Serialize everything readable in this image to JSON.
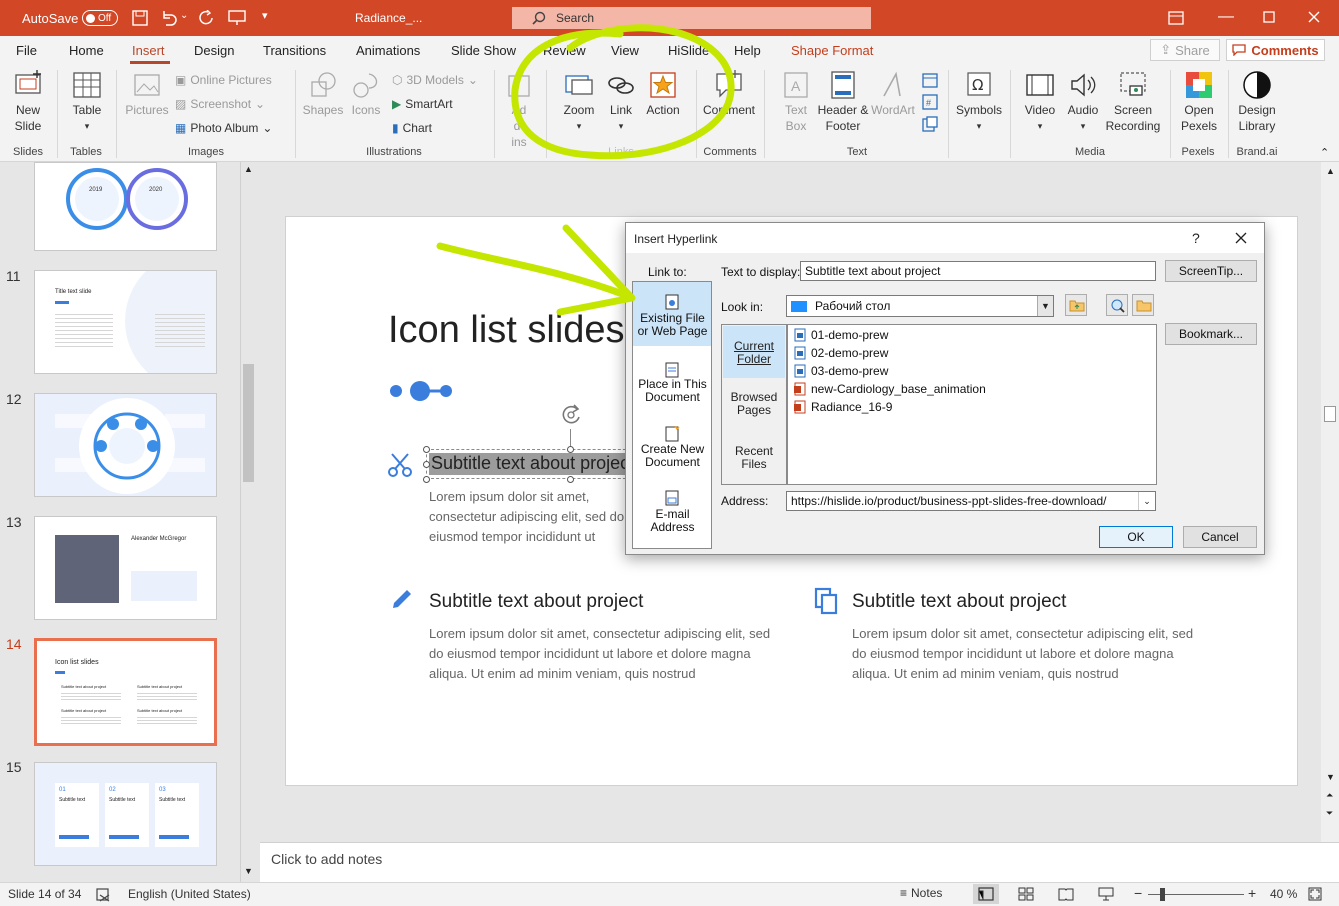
{
  "titlebar": {
    "autosave_label": "AutoSave",
    "autosave_state": "Off",
    "doc_title": "Radiance_...",
    "search_placeholder": "Search"
  },
  "tabs": [
    "File",
    "Home",
    "Insert",
    "Design",
    "Transitions",
    "Animations",
    "Slide Show",
    "Review",
    "View",
    "HiSlide",
    "Help",
    "Shape Format"
  ],
  "active_tab": "Insert",
  "share_label": "Share",
  "comments_label": "Comments",
  "ribbon": {
    "new_slide": "New Slide",
    "table": "Table",
    "pictures": "Pictures",
    "online_pictures": "Online Pictures",
    "screenshot": "Screenshot",
    "photo_album": "Photo Album",
    "shapes": "Shapes",
    "icons": "Icons",
    "models_3d": "3D Models",
    "smartart": "SmartArt",
    "chart": "Chart",
    "addins": "Add-ins",
    "zoom": "Zoom",
    "link": "Link",
    "action": "Action",
    "comment": "Comment",
    "text_box": "Text Box",
    "header_footer": "Header & Footer",
    "wordart": "WordArt",
    "symbols": "Symbols",
    "video": "Video",
    "audio": "Audio",
    "screen_recording": "Screen Recording",
    "open_pexels": "Open Pexels",
    "design_library": "Design Library",
    "groups": {
      "slides": "Slides",
      "tables": "Tables",
      "images": "Images",
      "illustrations": "Illustrations",
      "links": "Links",
      "comments": "Comments",
      "text": "Text",
      "media": "Media",
      "pexels": "Pexels",
      "brand": "Brand.ai"
    }
  },
  "thumbnails": [
    {
      "num": "",
      "label": ""
    },
    {
      "num": "11",
      "label": "Title text slide"
    },
    {
      "num": "12",
      "label": ""
    },
    {
      "num": "13",
      "label": "Alexander McGregor"
    },
    {
      "num": "14",
      "label": "Icon list slides"
    },
    {
      "num": "15",
      "label": "Subtitle text"
    }
  ],
  "thumb_extra": {
    "year_a": "2019",
    "year_b": "2020",
    "t14_item": "Subtitle text about project",
    "t15_nums": [
      "01",
      "02",
      "03"
    ]
  },
  "slide": {
    "title": "Icon list slides",
    "subtitle": "Subtitle text about project",
    "body": "Lorem ipsum dolor sit amet, consectetur adipiscing elit, sed do eiusmod tempor incididunt ut labore et dolore magna aliqua. Ut enim ad minim veniam, quis nostrud",
    "body_clipped": "Lorem ipsum dolor sit amet, consectetur adipiscing elit, sed do eiusmod tempor incididunt ut labore et dolore magna aliqua. Ut enim ad minim"
  },
  "notes_placeholder": "Click to add notes",
  "status": {
    "slide_info": "Slide 14 of 34",
    "language": "English (United States)",
    "notes": "Notes",
    "zoom": "40 %"
  },
  "dialog": {
    "title": "Insert Hyperlink",
    "help": "?",
    "link_to": "Link to:",
    "text_to_display_label": "Text to display:",
    "text_to_display_value": "Subtitle text about project",
    "screentip": "ScreenTip...",
    "look_in_label": "Look in:",
    "look_in_value": "Рабочий стол",
    "bookmark": "Bookmark...",
    "link_options": [
      {
        "label": "Existing File or Web Page"
      },
      {
        "label": "Place in This Document"
      },
      {
        "label": "Create New Document"
      },
      {
        "label": "E-mail Address"
      }
    ],
    "folder_tabs": [
      "Current Folder",
      "Browsed Pages",
      "Recent Files"
    ],
    "files": [
      {
        "name": "01-demo-prew",
        "type": "image"
      },
      {
        "name": "02-demo-prew",
        "type": "image"
      },
      {
        "name": "03-demo-prew",
        "type": "image"
      },
      {
        "name": "new-Cardiology_base_animation",
        "type": "pptx"
      },
      {
        "name": "Radiance_16-9",
        "type": "pptx"
      }
    ],
    "address_label": "Address:",
    "address_value": "https://hislide.io/product/business-ppt-slides-free-download/",
    "ok": "OK",
    "cancel": "Cancel"
  },
  "colors": {
    "accent": "#d24726",
    "slide_blue": "#3b7ddd",
    "highlight": "#c5e600",
    "selected_link": "#cce4f7"
  }
}
